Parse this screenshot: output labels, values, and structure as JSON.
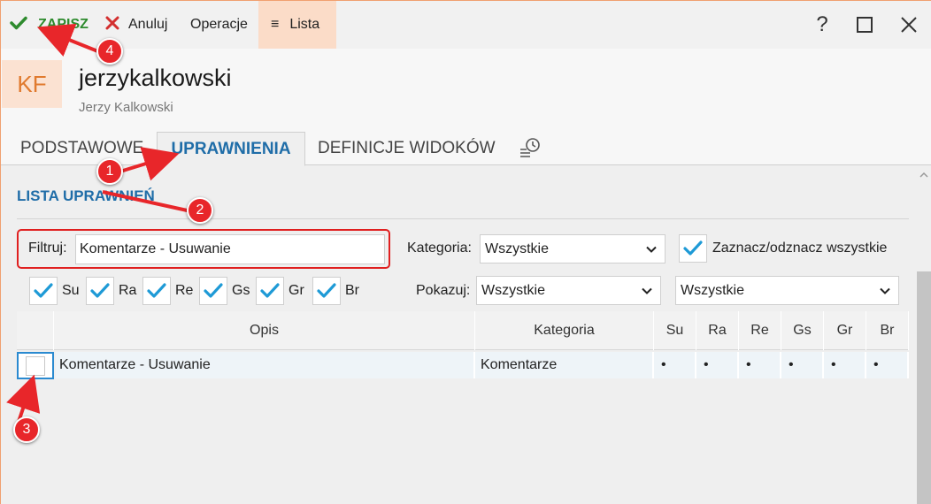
{
  "toolbar": {
    "save_label": "ZAPISZ",
    "cancel_label": "Anuluj",
    "operations_label": "Operacje",
    "list_label": "Lista",
    "help_label": "?",
    "list_icon": "≡"
  },
  "header": {
    "avatar_initials": "KF",
    "username": "jerzykalkowski",
    "full_name": "Jerzy Kalkowski"
  },
  "tabs": [
    {
      "label": "PODSTAWOWE"
    },
    {
      "label": "UPRAWNIENIA"
    },
    {
      "label": "DEFINICJE WIDOKÓW"
    }
  ],
  "permissions": {
    "section_title": "LISTA UPRAWNIEŃ",
    "filter_label": "Filtruj:",
    "filter_value": "Komentarze - Usuwanie",
    "category_label": "Kategoria:",
    "category_value": "Wszystkie",
    "select_all_label": "Zaznacz/odznacz wszystkie",
    "flags": [
      {
        "label": "Su",
        "checked": true
      },
      {
        "label": "Ra",
        "checked": true
      },
      {
        "label": "Re",
        "checked": true
      },
      {
        "label": "Gs",
        "checked": true
      },
      {
        "label": "Gr",
        "checked": true
      },
      {
        "label": "Br",
        "checked": true
      }
    ],
    "show_label": "Pokazuj:",
    "show_value_1": "Wszystkie",
    "show_value_2": "Wszystkie"
  },
  "grid": {
    "columns": [
      "Opis",
      "Kategoria",
      "Su",
      "Ra",
      "Re",
      "Gs",
      "Gr",
      "Br"
    ],
    "rows": [
      {
        "opis": "Komentarze - Usuwanie",
        "kategoria": "Komentarze",
        "su": "•",
        "ra": "•",
        "re": "•",
        "gs": "•",
        "gr": "•",
        "br": "•"
      }
    ]
  },
  "annotations": [
    "1",
    "2",
    "3",
    "4"
  ],
  "colors": {
    "accent_blue": "#1f6da8",
    "save_green": "#2e8b2e",
    "cancel_red": "#d32f2f",
    "check_blue": "#1e9ad6",
    "annotation_red": "#e8262a",
    "list_bg": "#fbdcc8"
  }
}
